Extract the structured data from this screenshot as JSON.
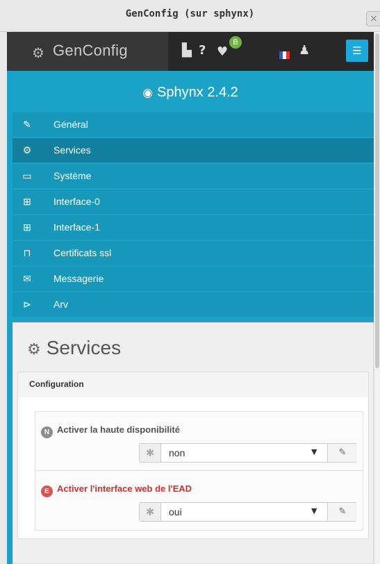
{
  "window": {
    "title": "GenConfig (sur sphynx)",
    "close": "×"
  },
  "appbar": {
    "brand": "GenConfig",
    "brand_icon": "gears-icon",
    "tools": {
      "file": "▙",
      "help": "?",
      "tag": "♥",
      "badge": "B",
      "user": "♟",
      "menu": "☰"
    },
    "colors": {
      "accent": "#1ca9d9",
      "badge": "#6db33f"
    }
  },
  "product": {
    "name": "Sphynx 2.4.2",
    "icon": "dashboard-icon"
  },
  "nav": {
    "items": [
      {
        "label": "Général",
        "icon": "wrench-icon",
        "glyph": "✎"
      },
      {
        "label": "Services",
        "icon": "gears-icon",
        "glyph": "⚙"
      },
      {
        "label": "Système",
        "icon": "desktop-icon",
        "glyph": "▭"
      },
      {
        "label": "Interface-0",
        "icon": "sitemap-icon",
        "glyph": "⊞"
      },
      {
        "label": "Interface-1",
        "icon": "sitemap-icon",
        "glyph": "⊞"
      },
      {
        "label": "Certificats ssl",
        "icon": "lock-icon",
        "glyph": "⊓"
      },
      {
        "label": "Messagerie",
        "icon": "envelope-icon",
        "glyph": "✉"
      },
      {
        "label": "Arv",
        "icon": "tags-icon",
        "glyph": "⊳"
      }
    ],
    "active_index": 1
  },
  "panel": {
    "title": "Services",
    "section": "Configuration",
    "fields": [
      {
        "mode": "N",
        "label": "Activer la haute disponibilité",
        "value": "non"
      },
      {
        "mode": "E",
        "label": "Activer l'interface web de l'EAD",
        "value": "oui"
      }
    ]
  }
}
